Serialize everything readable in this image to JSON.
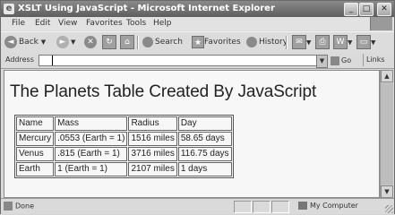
{
  "window": {
    "title": "XSLT Using JavaScript - Microsoft Internet Explorer",
    "controls": {
      "minimize": "_",
      "maximize": "□",
      "close": "✕"
    }
  },
  "menu": [
    "File",
    "Edit",
    "View",
    "Favorites",
    "Tools",
    "Help"
  ],
  "toolbar": {
    "back": "Back",
    "search": "Search",
    "favorites": "Favorites",
    "history": "History"
  },
  "address": {
    "label": "Address",
    "value": "",
    "go": "Go",
    "links": "Links"
  },
  "page": {
    "heading": "The Planets Table Created By JavaScript",
    "table": {
      "headers": [
        "Name",
        "Mass",
        "Radius",
        "Day"
      ],
      "rows": [
        [
          "Mercury",
          ".0553 (Earth = 1)",
          "1516 miles",
          "58.65 days"
        ],
        [
          "Venus",
          ".815 (Earth = 1)",
          "3716 miles",
          "116.75 days"
        ],
        [
          "Earth",
          "1 (Earth = 1)",
          "2107 miles",
          "1 days"
        ]
      ]
    }
  },
  "status": {
    "text": "Done",
    "zone": "My Computer"
  },
  "colors": {
    "titlebar": "#5e5e5e",
    "content_bg": "#f7f7f7",
    "chrome": "#d9d9d9"
  }
}
